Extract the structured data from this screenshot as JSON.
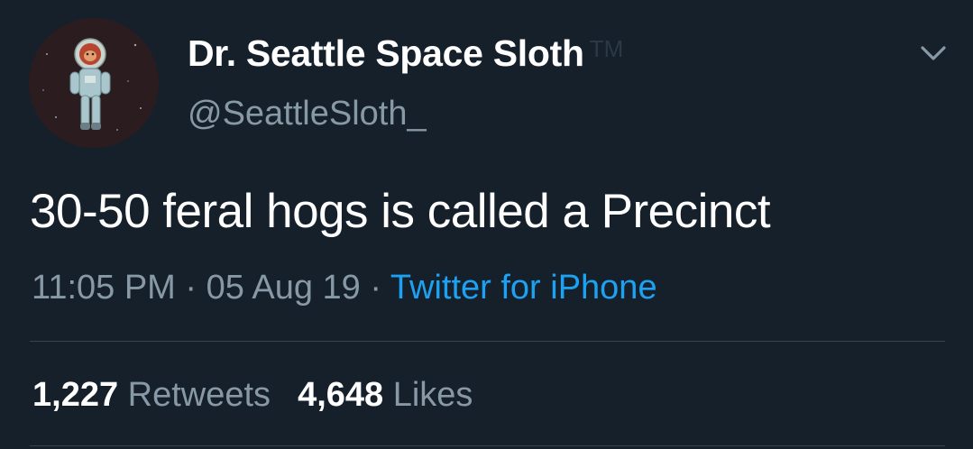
{
  "author": {
    "display_name": "Dr. Seattle Space Sloth",
    "name_suffix": "TM",
    "handle": "@SeattleSloth_",
    "avatar_icon": "astronaut-sloth-avatar"
  },
  "tweet": {
    "text": "30-50 feral hogs is called a Precinct",
    "time": "11:05 PM",
    "separator": "·",
    "date": "05 Aug 19",
    "source": "Twitter for iPhone"
  },
  "stats": {
    "retweets_count": "1,227",
    "retweets_label": "Retweets",
    "likes_count": "4,648",
    "likes_label": "Likes"
  },
  "menu": {
    "caret_icon": "chevron-down-icon"
  },
  "colors": {
    "background": "#15202b",
    "primary_text": "#ffffff",
    "secondary_text": "#8899a6",
    "link": "#1da1f2",
    "divider": "#38444d"
  }
}
